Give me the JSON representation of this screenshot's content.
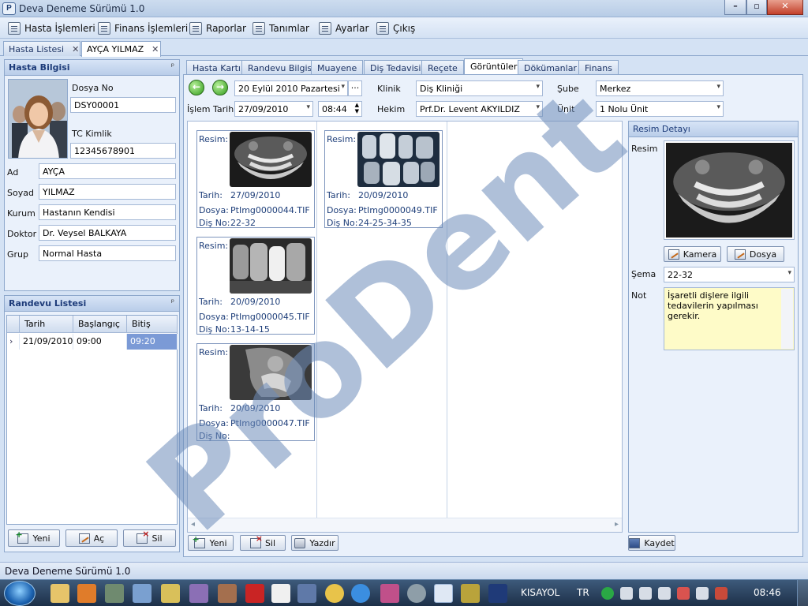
{
  "app": {
    "title": "Deva Deneme Sürümü 1.0"
  },
  "menu": [
    "Hasta İşlemleri",
    "Finans İşlemleri",
    "Raporlar",
    "Tanımlar",
    "Ayarlar",
    "Çıkış"
  ],
  "doc_tabs": [
    {
      "label": "Hasta Listesi"
    },
    {
      "label": "AYÇA YILMAZ"
    }
  ],
  "patient": {
    "header": "Hasta Bilgisi",
    "file_no_label": "Dosya No",
    "file_no": "DSY00001",
    "tc_label": "TC Kimlik",
    "tc": "12345678901",
    "fields": [
      {
        "label": "Ad",
        "value": "AYÇA"
      },
      {
        "label": "Soyad",
        "value": "YILMAZ"
      },
      {
        "label": "Kurum",
        "value": "Hastanın Kendisi"
      },
      {
        "label": "Doktor",
        "value": "Dr. Veysel BALKAYA"
      },
      {
        "label": "Grup",
        "value": "Normal Hasta"
      }
    ]
  },
  "appointments": {
    "header": "Randevu Listesi",
    "columns": [
      "Tarih",
      "Başlangıç",
      "Bitiş"
    ],
    "rows": [
      [
        "21/09/2010",
        "09:00",
        "09:20"
      ]
    ],
    "buttons": [
      "Yeni",
      "Aç",
      "Sil"
    ]
  },
  "sub_tabs": [
    "Hasta Kartı",
    "Randevu Bilgisi",
    "Muayene",
    "Diş Tedavisi",
    "Reçete",
    "Görüntüler",
    "Dökümanlar",
    "Finans"
  ],
  "toolbar": {
    "date_long": "20 Eylül  2010 Pazartesi",
    "islem_label": "İşlem Tarihi",
    "islem_date": "27/09/2010",
    "time": "08:44",
    "klinik_label": "Klinik",
    "klinik": "Diş Kliniği",
    "hekim_label": "Hekim",
    "hekim": "Prf.Dr. Levent AKYILDIZ",
    "sube_label": "Şube",
    "sube": "Merkez",
    "unit_label": "Ünit",
    "unit": "1 Nolu Ünit",
    "more": "···"
  },
  "cards_labels": {
    "resim": "Resim:",
    "tarih": "Tarih:",
    "dosya": "Dosya:",
    "disno": "Diş No:"
  },
  "images": [
    {
      "date": "27/09/2010",
      "file": "PtImg0000044.TIF",
      "teeth": "22-32"
    },
    {
      "date": "20/09/2010",
      "file": "PtImg0000049.TIF",
      "teeth": "24-25-34-35"
    },
    {
      "date": "20/09/2010",
      "file": "PtImg0000045.TIF",
      "teeth": "13-14-15"
    },
    {
      "date": "20/09/2010",
      "file": "PtImg0000047.TIF",
      "teeth": ""
    }
  ],
  "gallery_buttons": [
    "Yeni",
    "Sil",
    "Yazdır"
  ],
  "detail": {
    "header": "Resim Detayı",
    "resim_label": "Resim",
    "camera": "Kamera",
    "file_btn": "Dosya",
    "sema_label": "Şema",
    "sema": "22-32",
    "not_label": "Not",
    "note": "İşaretli dişlere ilgili tedavilerin yapılması gerekir.",
    "save": "Kaydet"
  },
  "watermark": "ProDent",
  "status": "Deva Deneme Sürümü 1.0",
  "taskbar": {
    "kisayol": "KISAYOL",
    "lang": "TR",
    "clock": "08:46"
  },
  "colors": {
    "accent": "#1d3b79",
    "selected": "#7b9ad6"
  }
}
